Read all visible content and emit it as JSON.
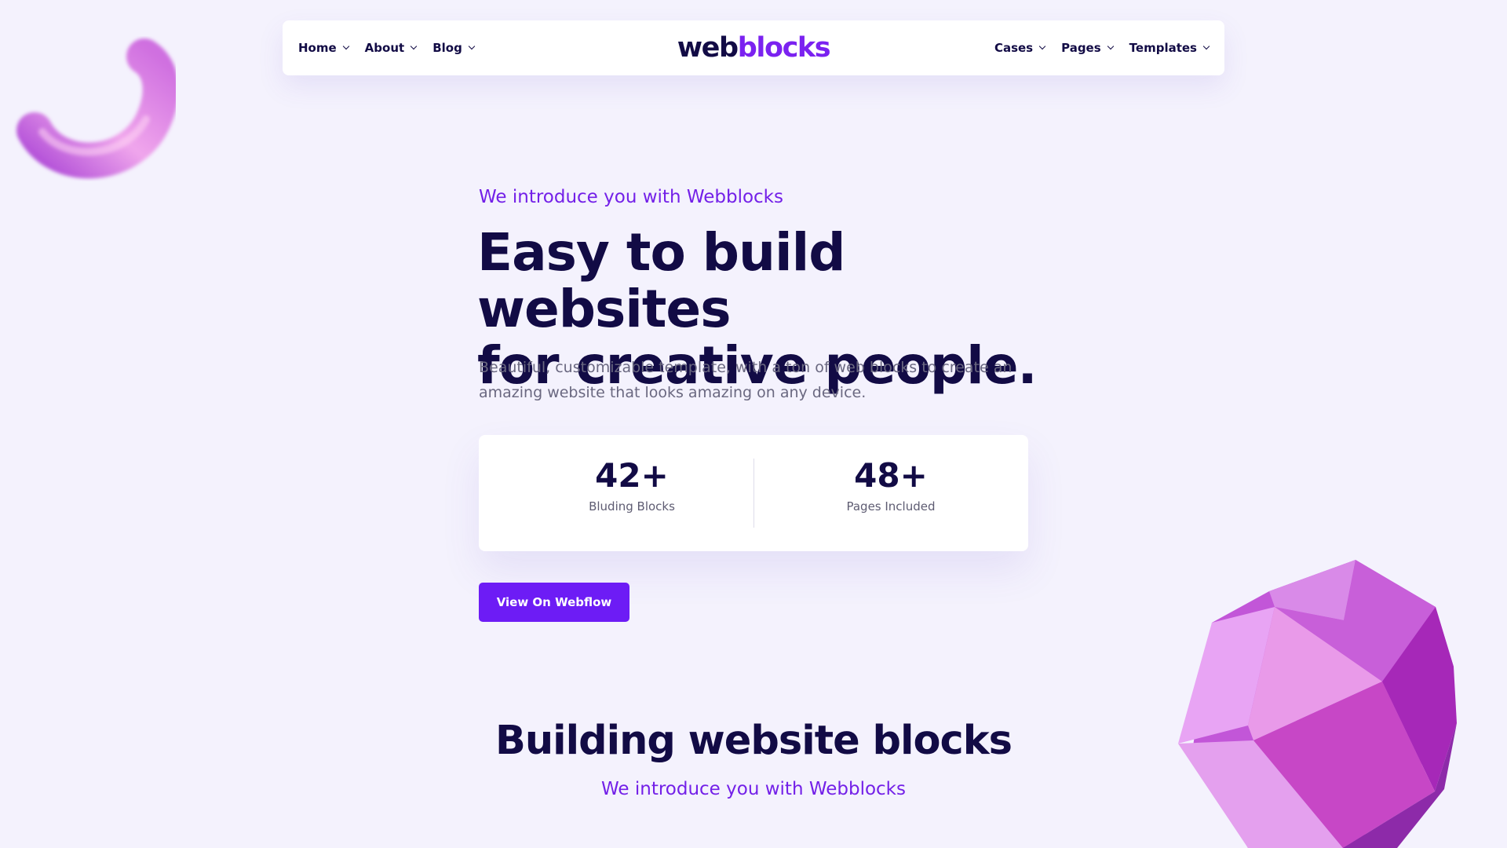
{
  "nav": {
    "left_items": [
      {
        "label": "Home"
      },
      {
        "label": "About"
      },
      {
        "label": "Blog"
      }
    ],
    "right_items": [
      {
        "label": "Cases"
      },
      {
        "label": "Pages"
      },
      {
        "label": "Templates"
      }
    ],
    "icon": "chevron-down-icon"
  },
  "logo": {
    "part1": "web",
    "part2": "blocks"
  },
  "hero": {
    "kicker": "We introduce you with Webblocks",
    "title_line1": "Easy to build websites",
    "title_line2": "for creative people.",
    "subtitle": "Beautiful, customizable template, with a ton of web blocks to create an amazing website that looks amazing on any device.",
    "stats": [
      {
        "value": "42+",
        "label": "Bluding Blocks"
      },
      {
        "value": "48+",
        "label": "Pages Included"
      }
    ],
    "cta_label": "View On Webflow"
  },
  "section": {
    "title": "Building website blocks",
    "kicker": "We introduce you with Webblocks"
  },
  "colors": {
    "background": "#f4f2fd",
    "navy": "#120b45",
    "accent": "#6d1cf5",
    "accent_text": "#7320e8",
    "muted_text": "#6a6880",
    "card": "#ffffff"
  }
}
